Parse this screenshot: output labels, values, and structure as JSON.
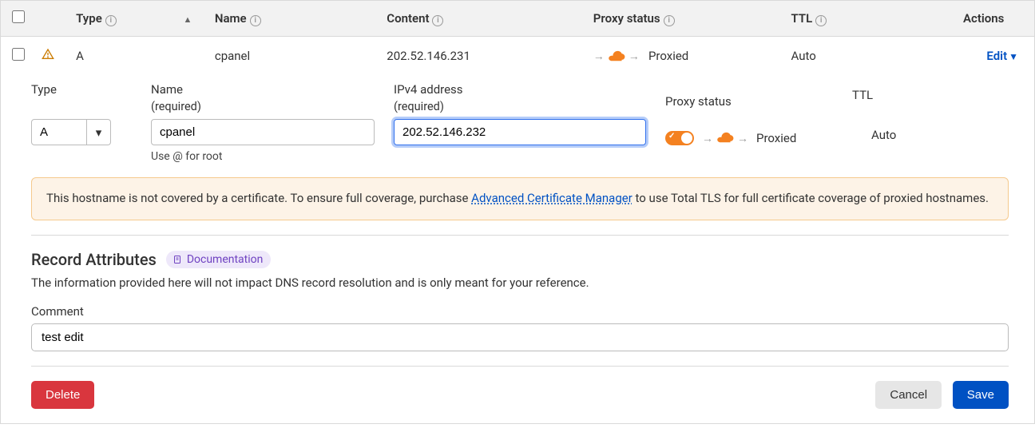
{
  "table": {
    "headers": {
      "type": "Type",
      "name": "Name",
      "content": "Content",
      "proxy": "Proxy status",
      "ttl": "TTL",
      "actions": "Actions"
    },
    "row": {
      "type": "A",
      "name": "cpanel",
      "content": "202.52.146.231",
      "proxy": "Proxied",
      "ttl": "Auto",
      "edit": "Edit"
    }
  },
  "edit": {
    "type_label": "Type",
    "type_value": "A",
    "name_label": "Name",
    "name_required": "(required)",
    "name_value": "cpanel",
    "name_hint": "Use @ for root",
    "ip_label": "IPv4 address",
    "ip_required": "(required)",
    "ip_value": "202.52.146.232",
    "proxy_label": "Proxy status",
    "proxy_value": "Proxied",
    "ttl_label": "TTL",
    "ttl_value": "Auto"
  },
  "warning": {
    "pre": "This hostname is not covered by a certificate. To ensure full coverage, purchase ",
    "link": "Advanced Certificate Manager",
    "post": " to use Total TLS for full certificate coverage of proxied hostnames."
  },
  "attributes": {
    "title": "Record Attributes",
    "doc": "Documentation",
    "sub": "The information provided here will not impact DNS record resolution and is only meant for your reference.",
    "comment_label": "Comment",
    "comment_value": "test edit"
  },
  "buttons": {
    "delete": "Delete",
    "cancel": "Cancel",
    "save": "Save"
  }
}
